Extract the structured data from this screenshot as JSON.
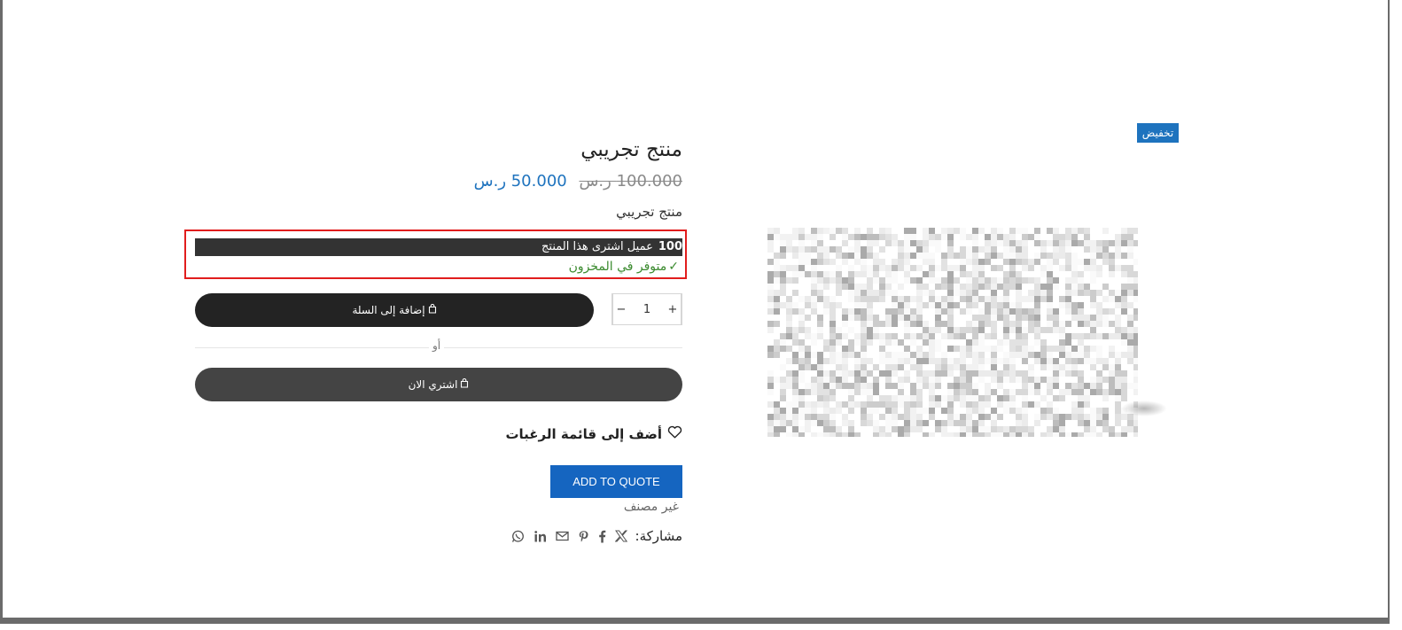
{
  "badge": {
    "label": "تخفيض"
  },
  "product": {
    "title": "منتج تجريبي",
    "price_old": "100.000  ر.س",
    "price_new": "50.000  ر.س",
    "short_description": "منتج تجريبي",
    "sales_count": "100",
    "sales_text": "عميل اشترى هذا المنتج",
    "stock_text": "متوفر في المخزون",
    "quantity": "1",
    "category": "غير مصنف"
  },
  "buttons": {
    "add_to_cart": "إضافة إلى السلة",
    "or": "أو",
    "buy_now": "اشتري الان",
    "wishlist": "أضف إلى قائمة الرغبات",
    "add_to_quote": "ADD TO QUOTE"
  },
  "share": {
    "label": "مشاركة:",
    "networks": [
      "x-icon",
      "facebook-icon",
      "pinterest-icon",
      "email-icon",
      "linkedin-icon",
      "whatsapp-icon"
    ]
  },
  "colors": {
    "accent": "#1e73be",
    "quote": "#1565c0",
    "stock": "#3a8a2e",
    "highlight": "#e11d1d"
  }
}
